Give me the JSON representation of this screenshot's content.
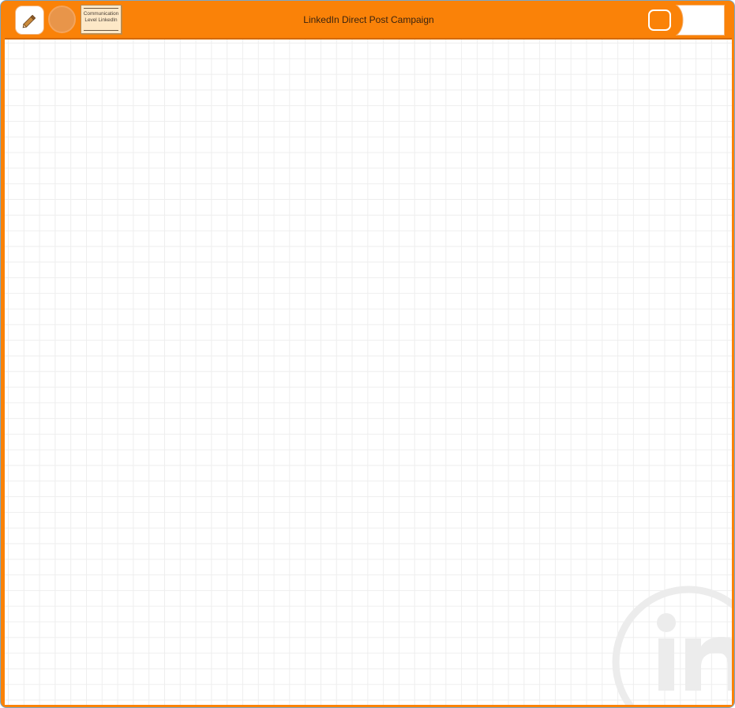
{
  "window": {
    "title": "LinkedIn Direct Post Campaign"
  },
  "toolbar": {
    "note_card_line1": "Communication",
    "note_card_line2": "Level LinkedIn"
  },
  "colors": {
    "accent": "#fa8208",
    "toolbar_background": "#fa8208",
    "canvas_background": "#ffffff",
    "grid_line": "#eeeeee",
    "watermark": "#ececec"
  },
  "icons": {
    "pencil": "pencil-icon",
    "circle": "circle-shape-icon",
    "window": "window-icon",
    "tab": "tab-arrow-icon",
    "watermark": "linkedin-logo"
  }
}
